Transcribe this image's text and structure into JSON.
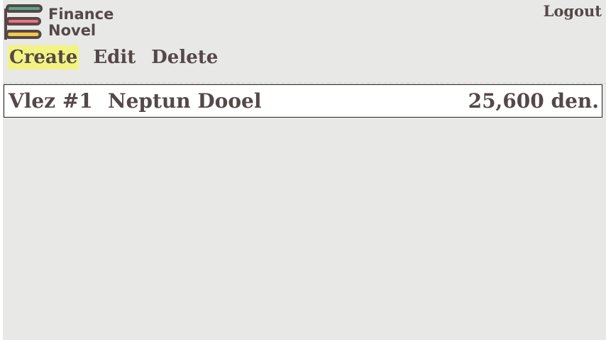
{
  "brand": {
    "line1": "Finance",
    "line2": "Novel",
    "logo_icon": "books-stack-icon",
    "colors": {
      "green": "#5aa68a",
      "red": "#f07080",
      "yellow": "#f3c84a",
      "outline": "#554848"
    }
  },
  "header": {
    "logout_label": "Logout"
  },
  "nav": {
    "items": [
      {
        "label": "Create",
        "active": true
      },
      {
        "label": "Edit",
        "active": false
      },
      {
        "label": "Delete",
        "active": false
      }
    ],
    "active_color": "#f3f382"
  },
  "table": {
    "rows": [
      {
        "id": "Vlez #1",
        "name": "Neptun Dooel",
        "amount": "25,600 den."
      }
    ]
  }
}
